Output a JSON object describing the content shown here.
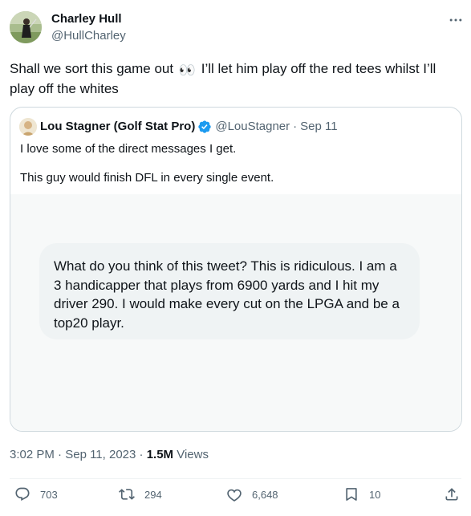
{
  "author": {
    "name": "Charley Hull",
    "handle": "@HullCharley"
  },
  "tweet": {
    "text_before_emoji": "Shall we sort this game out",
    "emoji": "👀",
    "text_after_emoji": "I’ll let him play off the red tees whilst I’ll play off the whites"
  },
  "quote": {
    "name": "Lou Stagner (Golf Stat Pro)",
    "handle": "@LouStagner",
    "separator": "·",
    "date": "Sep 11",
    "line1": "I love some of the direct messages I get.",
    "line2": "This guy would finish DFL in every single event.",
    "dm_text": "What do you think of this tweet? This is ridiculous. I am a 3 handicapper that plays from 6900 yards and I hit my driver 290. I would make every cut on the LPGA and be a top20 playr."
  },
  "meta": {
    "time": "3:02 PM",
    "separator": "·",
    "date": "Sep 11, 2023",
    "separator2": "·",
    "views_count": "1.5M",
    "views_label": "Views"
  },
  "actions": {
    "replies": "703",
    "retweets": "294",
    "likes": "6,648",
    "bookmarks": "10"
  },
  "colors": {
    "text": "#0f1419",
    "secondary": "#536471",
    "border": "#cfd9de",
    "verified": "#1d9bf0"
  }
}
